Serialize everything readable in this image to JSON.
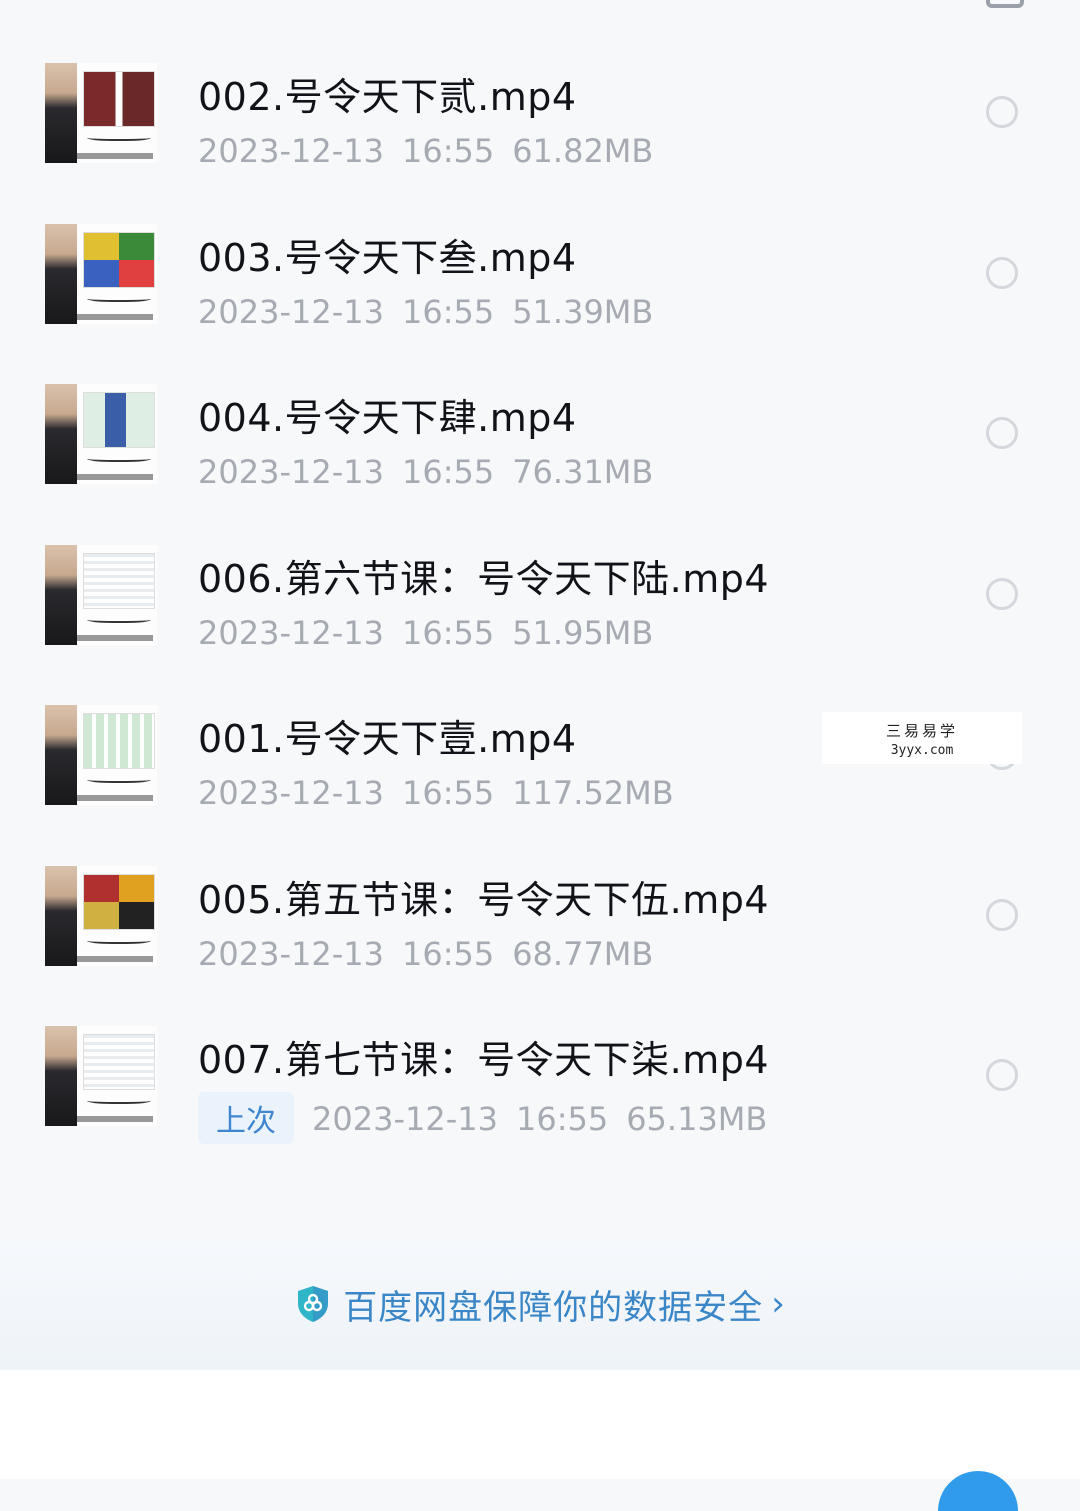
{
  "files": [
    {
      "name": "002.号令天下贰.mp4",
      "date": "2023-12-13",
      "time": "16:55",
      "size": "61.82MB",
      "tag": ""
    },
    {
      "name": "003.号令天下叁.mp4",
      "date": "2023-12-13",
      "time": "16:55",
      "size": "51.39MB",
      "tag": ""
    },
    {
      "name": "004.号令天下肆.mp4",
      "date": "2023-12-13",
      "time": "16:55",
      "size": "76.31MB",
      "tag": ""
    },
    {
      "name": "006.第六节课：号令天下陆.mp4",
      "date": "2023-12-13",
      "time": "16:55",
      "size": "51.95MB",
      "tag": ""
    },
    {
      "name": "001.号令天下壹.mp4",
      "date": "2023-12-13",
      "time": "16:55",
      "size": "117.52MB",
      "tag": ""
    },
    {
      "name": "005.第五节课：号令天下伍.mp4",
      "date": "2023-12-13",
      "time": "16:55",
      "size": "68.77MB",
      "tag": ""
    },
    {
      "name": "007.第七节课：号令天下柒.mp4",
      "date": "2023-12-13",
      "time": "16:55",
      "size": "65.13MB",
      "tag": "上次"
    }
  ],
  "watermark": {
    "line1": "三易易学",
    "line2": "3yyx.com"
  },
  "security_banner": {
    "text": "百度网盘保障你的数据安全"
  },
  "colors": {
    "accent": "#3a86c6",
    "tag_bg": "#eaf3fc",
    "meta_text": "#a6aab2",
    "shield": "#2fb5c8"
  }
}
